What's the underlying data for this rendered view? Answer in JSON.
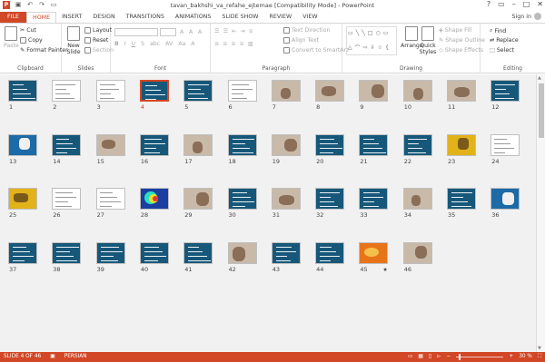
{
  "window": {
    "title": "tavan_bakhshi_va_refahe_ejtemae [Compatibility Mode] - PowerPoint",
    "signin": "Sign in"
  },
  "qat": [
    "save-icon",
    "undo-icon",
    "redo-icon",
    "start-slideshow-icon"
  ],
  "tabs": [
    "FILE",
    "HOME",
    "INSERT",
    "DESIGN",
    "TRANSITIONS",
    "ANIMATIONS",
    "SLIDE SHOW",
    "REVIEW",
    "VIEW"
  ],
  "active_tab": "HOME",
  "ribbon": {
    "clipboard": {
      "label": "Clipboard",
      "paste": "Paste",
      "cut": "Cut",
      "copy": "Copy",
      "format_painter": "Format Painter"
    },
    "slides": {
      "label": "Slides",
      "new_slide": "New Slide",
      "layout": "Layout",
      "reset": "Reset",
      "section": "Section"
    },
    "font": {
      "label": "Font",
      "font_name": "",
      "font_size": "",
      "grow": "A",
      "shrink": "A",
      "clear": "A",
      "case": "Aa",
      "color": "A"
    },
    "paragraph": {
      "label": "Paragraph",
      "text_direction": "Text Direction",
      "align_text": "Align Text",
      "smartart": "Convert to SmartArt"
    },
    "drawing": {
      "label": "Drawing",
      "arrange": "Arrange",
      "quick_styles": "Quick Styles",
      "shape_fill": "Shape Fill",
      "shape_outline": "Shape Outline",
      "shape_effects": "Shape Effects"
    },
    "editing": {
      "label": "Editing",
      "find": "Find",
      "replace": "Replace",
      "select": "Select"
    }
  },
  "selected_slide": 4,
  "slides": [
    {
      "n": "1",
      "s": "teal"
    },
    {
      "n": "2",
      "s": "white"
    },
    {
      "n": "3",
      "s": "white"
    },
    {
      "n": "4",
      "s": "teal"
    },
    {
      "n": "5",
      "s": "teal"
    },
    {
      "n": "6",
      "s": "white"
    },
    {
      "n": "7",
      "s": "photo"
    },
    {
      "n": "8",
      "s": "photo"
    },
    {
      "n": "9",
      "s": "photo"
    },
    {
      "n": "10",
      "s": "photo"
    },
    {
      "n": "11",
      "s": "photo"
    },
    {
      "n": "12",
      "s": "teal"
    },
    {
      "n": "13",
      "s": "blue"
    },
    {
      "n": "14",
      "s": "teal"
    },
    {
      "n": "15",
      "s": "photo"
    },
    {
      "n": "16",
      "s": "teal"
    },
    {
      "n": "17",
      "s": "photo"
    },
    {
      "n": "18",
      "s": "teal"
    },
    {
      "n": "19",
      "s": "photo"
    },
    {
      "n": "20",
      "s": "teal"
    },
    {
      "n": "21",
      "s": "teal"
    },
    {
      "n": "22",
      "s": "teal"
    },
    {
      "n": "23",
      "s": "yellow"
    },
    {
      "n": "24",
      "s": "white"
    },
    {
      "n": "25",
      "s": "yellow"
    },
    {
      "n": "26",
      "s": "white"
    },
    {
      "n": "27",
      "s": "white"
    },
    {
      "n": "28",
      "s": "heat"
    },
    {
      "n": "29",
      "s": "photo"
    },
    {
      "n": "30",
      "s": "teal"
    },
    {
      "n": "31",
      "s": "photo"
    },
    {
      "n": "32",
      "s": "teal"
    },
    {
      "n": "33",
      "s": "teal"
    },
    {
      "n": "34",
      "s": "photo"
    },
    {
      "n": "35",
      "s": "teal"
    },
    {
      "n": "36",
      "s": "blue"
    },
    {
      "n": "37",
      "s": "teal"
    },
    {
      "n": "38",
      "s": "teal"
    },
    {
      "n": "39",
      "s": "teal"
    },
    {
      "n": "40",
      "s": "teal"
    },
    {
      "n": "41",
      "s": "teal"
    },
    {
      "n": "42",
      "s": "photo"
    },
    {
      "n": "43",
      "s": "teal"
    },
    {
      "n": "44",
      "s": "teal"
    },
    {
      "n": "45",
      "s": "orange",
      "star": "★"
    },
    {
      "n": "46",
      "s": "photo"
    }
  ],
  "status": {
    "slide": "SLIDE 4 OF 46",
    "language": "PERSIAN",
    "zoom": "30 %",
    "zoom_level": 30
  },
  "colors": {
    "accent": "#d24726",
    "teal": "#17587a"
  }
}
